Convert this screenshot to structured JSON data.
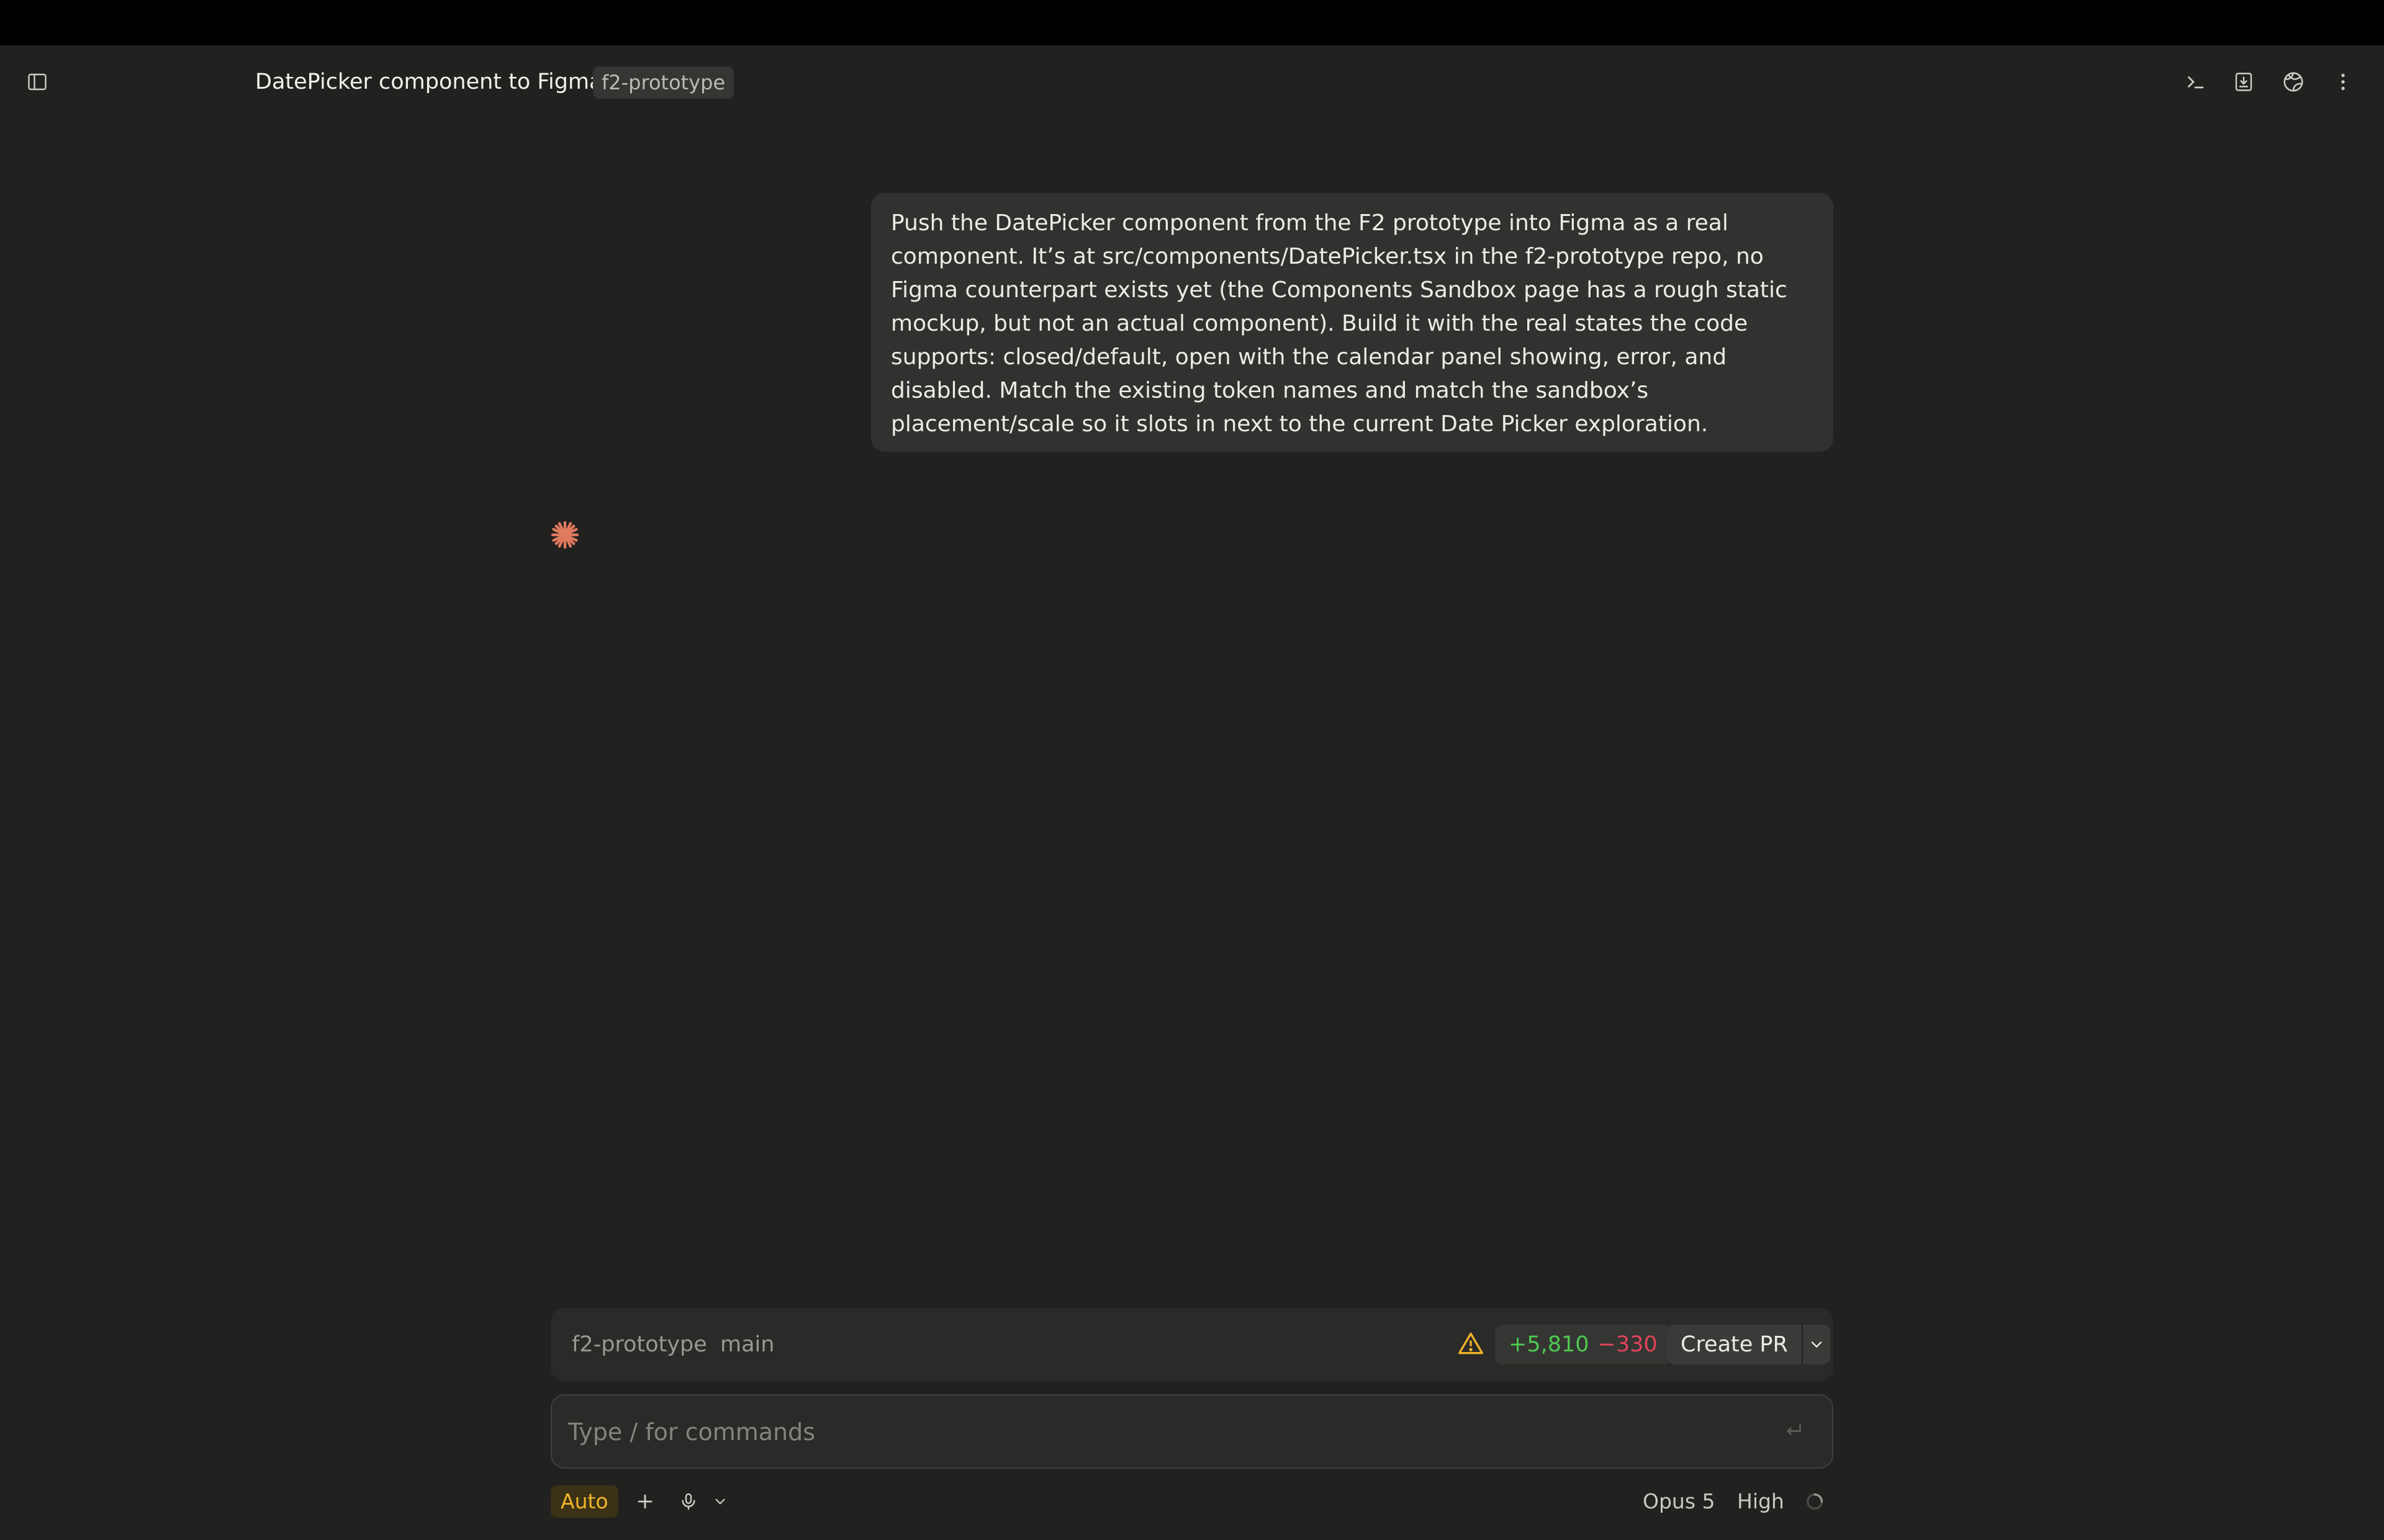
{
  "header": {
    "title": "DatePicker component to Figma",
    "repo_badge": "f2-prototype",
    "icons": [
      "sidebar-toggle-icon",
      "terminal-icon",
      "download-icon",
      "globe-icon",
      "more-icon"
    ]
  },
  "message": {
    "text": "Push the DatePicker component from the F2 prototype into Figma as a real component. It’s at src/components/DatePicker.tsx in the f2-prototype repo, no Figma counterpart exists yet (the Components Sandbox page has a rough static mockup, but not an actual component). Build it with the real states the code supports: closed/default, open with the calendar panel showing, error, and disabled. Match the existing token names and match the sandbox’s placement/scale so it slots in next to the current Date Picker exploration."
  },
  "status": {
    "repo": "f2-prototype",
    "branch": "main",
    "additions": "+5,810",
    "deletions": "−330",
    "create_pr_label": "Create PR"
  },
  "composer": {
    "placeholder": "Type / for commands"
  },
  "footer": {
    "mode": "Auto",
    "model": "Opus 5",
    "effort": "High"
  },
  "colors": {
    "accent_spark": "#e07a5f",
    "additions": "#4ec94e",
    "deletions": "#e0445a",
    "auto_badge": "#f0b429"
  }
}
